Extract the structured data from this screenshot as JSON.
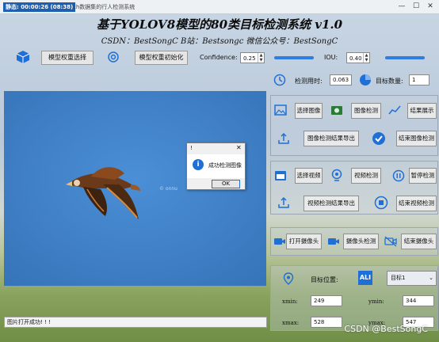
{
  "titlebar": {
    "time": "静态: 00:00:26 (08:38)",
    "app_name": "ch数据集的行人检测系统",
    "minimize": "—",
    "maximize": "☐",
    "close": "✕"
  },
  "header": {
    "title": "基于YOLOV8模型的80类目标检测系统 v1.0",
    "subtitle": "CSDN：BestSongC   B站：Bestsongc   微信公众号：BestSongC"
  },
  "toolbar": {
    "model_select": "模型权重选择",
    "model_init": "模型权重初始化",
    "confidence_label": "Confidence:",
    "confidence_value": "0.25",
    "iou_label": "IOU:",
    "iou_value": "0.40",
    "confidence_level": 0.25,
    "iou_level": 0.4
  },
  "stats": {
    "time_label": "检测用时:",
    "time_value": "0.063",
    "count_label": "目标数量:",
    "count_value": "1"
  },
  "image_panel": {
    "select_image": "选择图像",
    "detect_image": "图像检测",
    "show_result": "结果展示",
    "export_image": "图像检测结果导出",
    "end_image": "结束图像检测"
  },
  "video_panel": {
    "select_video": "选择视频",
    "detect_video": "视频检测",
    "pause": "暂停检测",
    "export_video": "视频检测结果导出",
    "end_video": "结束视频检测"
  },
  "camera_panel": {
    "open_camera": "打开摄像头",
    "detect_camera": "摄像头检测",
    "end_camera": "结束摄像头"
  },
  "target_panel": {
    "position_label": "目标位置:",
    "target_select": "目标1",
    "xmin_label": "xmin:",
    "xmin": "249",
    "ymin_label": "ymin:",
    "ymin": "344",
    "xmax_label": "xmax:",
    "xmax": "528",
    "ymax_label": "ymax:",
    "ymax": "547"
  },
  "image_watermark": "© onnu",
  "dialog": {
    "title": "!",
    "message": "成功检测图像",
    "ok": "OK",
    "close": "✕"
  },
  "status_text": "图片打开成功! ! !",
  "watermark": "CSDN @BestSongC",
  "colors": {
    "accent": "#1f6fd6",
    "image_bg": "#3f7fc4",
    "slider": "#2f7de1"
  }
}
